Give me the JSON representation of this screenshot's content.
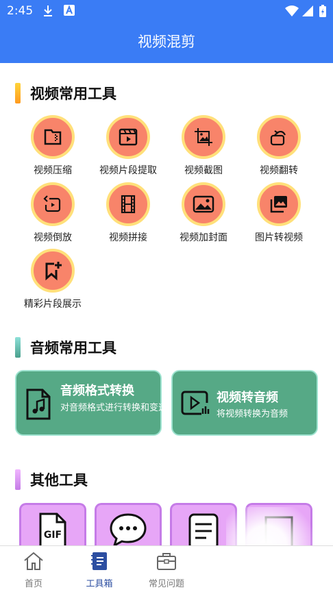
{
  "status": {
    "time": "2:45"
  },
  "app": {
    "title": "视频混剪"
  },
  "sections": {
    "video": "视频常用工具",
    "audio": "音频常用工具",
    "other": "其他工具"
  },
  "video_tools": [
    {
      "label": "视频压缩",
      "icon": "zip-file-icon"
    },
    {
      "label": "视频片段提取",
      "icon": "film-clip-icon"
    },
    {
      "label": "视频截图",
      "icon": "image-crop-icon"
    },
    {
      "label": "视频翻转",
      "icon": "rotate-icon"
    },
    {
      "label": "视频倒放",
      "icon": "rewind-icon"
    },
    {
      "label": "视频拼接",
      "icon": "film-strip-icon"
    },
    {
      "label": "视频加封面",
      "icon": "picture-icon"
    },
    {
      "label": "图片转视频",
      "icon": "photos-icon"
    },
    {
      "label": "精彩片段展示",
      "icon": "bookmark-plus-icon"
    }
  ],
  "audio_tools": [
    {
      "title": "音频格式转换",
      "desc": "对音频格式进行转换和变速",
      "icon": "music-file-icon"
    },
    {
      "title": "视频转音频",
      "desc": "将视频转换为音频",
      "icon": "video-to-audio-icon"
    }
  ],
  "other_tools": [
    {
      "icon": "gif-file-icon",
      "text": "GIF"
    },
    {
      "icon": "chat-bubble-icon"
    },
    {
      "icon": "document-icon"
    },
    {
      "icon": "frame-icon"
    }
  ],
  "tabs": [
    {
      "label": "首页",
      "icon": "home-icon",
      "active": false
    },
    {
      "label": "工具箱",
      "icon": "toolbox-icon",
      "active": true
    },
    {
      "label": "常见问题",
      "icon": "briefcase-icon",
      "active": false
    }
  ],
  "colors": {
    "primary": "#3a7cf5",
    "tool_circle": "#f8846a",
    "tool_ring": "#ffe07a",
    "audio_card": "#56a986",
    "other_card": "#e7a6f7",
    "tab_active": "#2c4ea1"
  }
}
